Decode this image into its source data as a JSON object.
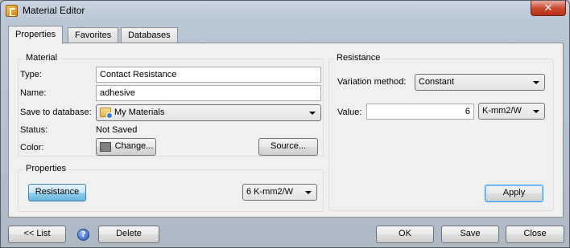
{
  "window": {
    "title": "Material Editor",
    "close_glyph": "✕"
  },
  "tabs": [
    {
      "label": "Properties",
      "active": true
    },
    {
      "label": "Favorites",
      "active": false
    },
    {
      "label": "Databases",
      "active": false
    }
  ],
  "material": {
    "group_title": "Material",
    "type_label": "Type:",
    "type_value": "Contact Resistance",
    "name_label": "Name:",
    "name_value": "adhesive",
    "save_label": "Save to database:",
    "save_value": "My Materials",
    "status_label": "Status:",
    "status_value": "Not Saved",
    "color_label": "Color:",
    "color_swatch": "#808080",
    "change_button": "Change...",
    "source_button": "Source..."
  },
  "properties": {
    "group_title": "Properties",
    "resistance_button": "Resistance",
    "value_combo": "6 K-mm2/W"
  },
  "resistance": {
    "group_title": "Resistance",
    "variation_label": "Variation method:",
    "variation_value": "Constant",
    "value_label": "Value:",
    "value": "6",
    "unit_value": "K-mm2/W",
    "apply_button": "Apply"
  },
  "footer": {
    "list_button": "<< List",
    "help_glyph": "?",
    "delete_button": "Delete",
    "ok_button": "OK",
    "save_button": "Save",
    "close_button": "Close"
  }
}
